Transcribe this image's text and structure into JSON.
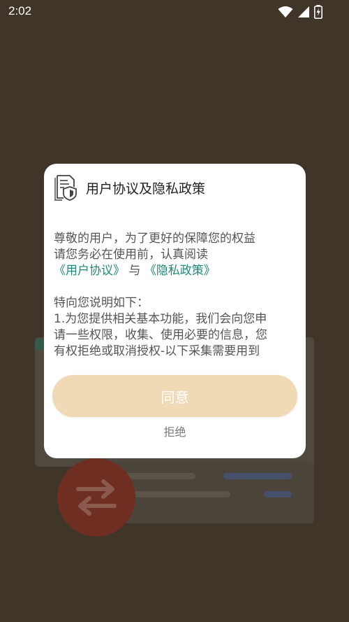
{
  "status_bar": {
    "time": "2:02",
    "icons": [
      "wifi-icon",
      "signal-icon",
      "battery-charging-icon"
    ]
  },
  "dialog": {
    "title": "用户协议及隐私政策",
    "icon": "privacy-shield-document-icon",
    "intro_line1": "尊敬的用户，为了更好的保障您的权益",
    "intro_line2": "请您务必在使用前，认真阅读",
    "user_agreement_link": "《用户协议》",
    "and_text": " 与 ",
    "privacy_policy_link": "《隐私政策》",
    "explain_heading": "特向您说明如下：",
    "explain_line1": "1.为您提供相关基本功能，我们会向您申",
    "explain_line2": "请一些权限，收集、使用必要的信息，您",
    "explain_line3": "有权拒绝或取消授权-以下采集需要用到",
    "explain_line4": "...",
    "agree_label": "同意",
    "reject_label": "拒绝"
  },
  "colors": {
    "overlay_background": "#3f3529",
    "dialog_background": "#ffffff",
    "link": "#1f8a7a",
    "agree_button": "#f0d9b5",
    "body_text": "#555555"
  }
}
